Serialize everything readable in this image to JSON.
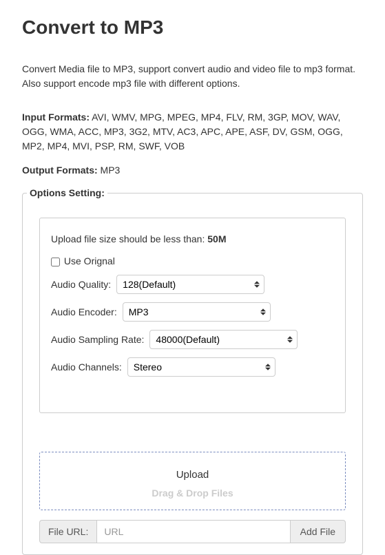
{
  "page": {
    "title": "Convert to MP3",
    "description": "Convert Media file to MP3, support convert audio and video file to mp3 format. Also support encode mp3 file with different options.",
    "input_formats_label": "Input Formats:",
    "input_formats_value": " AVI, WMV, MPG, MPEG, MP4, FLV, RM, 3GP, MOV, WAV, OGG, WMA, ACC, MP3, 3G2, MTV, AC3, APC, APE, ASF, DV, GSM, OGG, MP2, MP4, MVI, PSP, RM, SWF, VOB",
    "output_formats_label": "Output Formats:",
    "output_formats_value": " MP3"
  },
  "options": {
    "legend": "Options Setting:",
    "upload_note_prefix": "Upload file size should be less than: ",
    "upload_note_value": "50M",
    "use_original_label": "Use Orignal",
    "quality_label": "Audio Quality:",
    "quality_value": "128(Default)",
    "encoder_label": "Audio Encoder:",
    "encoder_value": "MP3",
    "sampling_label": "Audio Sampling Rate:",
    "sampling_value": "48000(Default)",
    "channels_label": "Audio Channels:",
    "channels_value": "Stereo"
  },
  "upload": {
    "title": "Upload",
    "drag_text": "Drag & Drop Files",
    "url_label": "File URL:",
    "url_placeholder": "URL",
    "add_file_button": "Add File"
  }
}
